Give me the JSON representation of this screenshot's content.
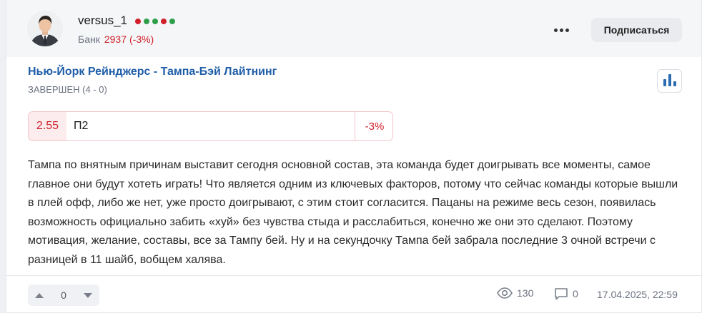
{
  "user": {
    "name": "versus_1",
    "form_dots": [
      "#d0212b",
      "#2e9e4a",
      "#2e9e4a",
      "#d0212b",
      "#2e9e4a"
    ],
    "bank_label": "Банк",
    "bank_value": "2937",
    "bank_change": "(-3%)",
    "avatar_icon": "person-avatar"
  },
  "header": {
    "more_icon": "more-dots-icon",
    "subscribe_label": "Подписаться"
  },
  "match": {
    "title": "Нью-Йорк Рейнджерс - Тампа-Бэй Лайтнинг",
    "status": "ЗАВЕРШЕН (4 - 0)",
    "stats_icon": "bar-chart-icon"
  },
  "bet": {
    "odds": "2.55",
    "pick": "П2",
    "result": "-3%"
  },
  "post": {
    "text": "Тампа по внятным причинам выставит сегодня основной состав, эта команда будет доигрывать все моменты, самое главное они будут хотеть играть! Что является одним из ключевых факторов, потому что сейчас команды которые вышли в плей офф, либо же нет, уже просто доигрывают, с этим стоит согласится. Пацаны на режиме весь сезон, появилась возможность официально забить «хуй» без чувства стыда и расслабиться, конечно же они это сделают. Поэтому мотивация, желание, составы, все за Тампу бей. Ну и на секундочку Тампа бей забрала последние 3 очной встречи с разницей в 11 шайб, вобщем халява."
  },
  "footer": {
    "votes": "0",
    "views": "130",
    "comments": "0",
    "timestamp": "17.04.2025, 22:59"
  },
  "colors": {
    "accent_blue": "#1f5ea8",
    "loss_red": "#d0212b",
    "win_green": "#2e9e4a"
  }
}
